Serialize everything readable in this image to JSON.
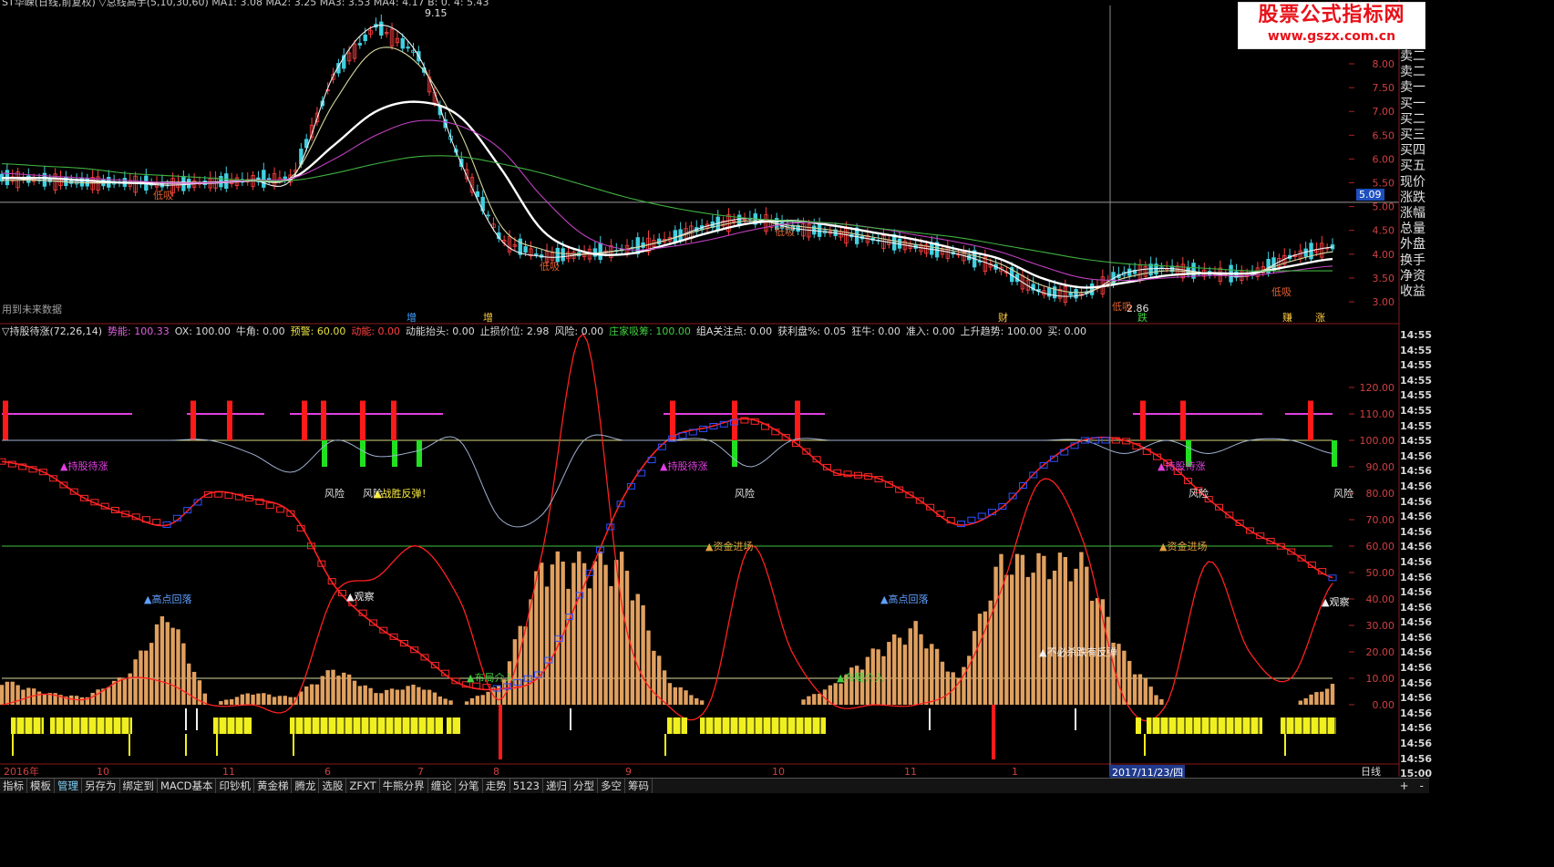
{
  "header_top": {
    "text": "ST华嵘(日线,前复权) ▽总线高手(5,10,30,60) MA1: 3.08 MA2: 3.25 MA3: 3.53 MA4: 4.17 B: 0. 4: 5.43"
  },
  "watermark": {
    "line1": "股票公式指标网",
    "line2": "www.gszx.com.cn"
  },
  "future_note": "用到未来数据",
  "indicator_header": [
    {
      "text": "▽持股待涨(72,26,14)",
      "color": "#dcdcdc"
    },
    {
      "text": "势能: 100.33",
      "color": "#e060e0"
    },
    {
      "text": "OX: 100.00",
      "color": "#dcdcdc"
    },
    {
      "text": "牛角: 0.00",
      "color": "#dcdcdc"
    },
    {
      "text": "预警: 60.00",
      "color": "#e8e040"
    },
    {
      "text": "动能: 0.00",
      "color": "#ff4040"
    },
    {
      "text": "动能抬头: 0.00",
      "color": "#dcdcdc"
    },
    {
      "text": "止损价位: 2.98",
      "color": "#dcdcdc"
    },
    {
      "text": "风险: 0.00",
      "color": "#dcdcdc"
    },
    {
      "text": "庄家吸筹: 100.00",
      "color": "#40d040"
    },
    {
      "text": "组A关注点: 0.00",
      "color": "#dcdcdc"
    },
    {
      "text": "获利盘%: 0.05",
      "color": "#dcdcdc"
    },
    {
      "text": "狂牛: 0.00",
      "color": "#dcdcdc"
    },
    {
      "text": "准入: 0.00",
      "color": "#dcdcdc"
    },
    {
      "text": "上升趋势: 100.00",
      "color": "#dcdcdc"
    },
    {
      "text": "买: 0.00",
      "color": "#dcdcdc"
    }
  ],
  "side_labels": [
    "卖二",
    "卖二",
    "卖一",
    "买一",
    "买二",
    "买三",
    "买四",
    "买五",
    "现价",
    "涨跌",
    "涨幅",
    "总量",
    "外盘",
    "换手",
    "净资",
    "收益"
  ],
  "time_labels": [
    "14:55",
    "14:55",
    "14:55",
    "14:55",
    "14:55",
    "14:55",
    "14:55",
    "14:55",
    "14:56",
    "14:56",
    "14:56",
    "14:56",
    "14:56",
    "14:56",
    "14:56",
    "14:56",
    "14:56",
    "14:56",
    "14:56",
    "14:56",
    "14:56",
    "14:56",
    "14:56",
    "14:56",
    "14:56",
    "14:56",
    "14:56",
    "14:56",
    "14:56",
    "15:00"
  ],
  "tabs": [
    "指标",
    "模板",
    "管理",
    "另存为",
    "绑定到",
    "MACD基本",
    "印钞机",
    "黄金梯",
    "腾龙",
    "选股",
    "ZFXT",
    "牛熊分界",
    "缠论",
    "分笔",
    "走势",
    "5123",
    "递归",
    "分型",
    "多空",
    "筹码"
  ],
  "active_tab": "管理",
  "day_badge": "日线",
  "cursor_date": "2017/11/23/四",
  "price_tag": "5.09",
  "tail_buttons": [
    "+",
    "-"
  ],
  "chart_data": [
    {
      "type": "line",
      "title": "ST华嵘(日线,前复权)",
      "y_axis": {
        "min": 3.0,
        "max": 8.0,
        "ticks": [
          8.0,
          7.5,
          7.0,
          6.5,
          6.0,
          5.5,
          5.0,
          4.5,
          4.0,
          3.5,
          3.0
        ],
        "tick_labels": [
          "8.00",
          "7.50",
          "7.00",
          "6.50",
          "6.00",
          "5.50",
          "5.00",
          "4.50",
          "4.00",
          "3.50",
          "3.00"
        ]
      },
      "x_time_labels": [
        "2016年",
        "10",
        "11",
        "6",
        "7",
        "8",
        "9",
        "10",
        "11",
        "1"
      ],
      "peak_label": "9.15",
      "low_label": "2.86",
      "price_level": 5.09,
      "series": [
        {
          "name": "MA1",
          "color": "#f0f0f0",
          "values": [
            5.6,
            5.55,
            5.5,
            5.5,
            5.45,
            5.5,
            5.55,
            5.6,
            7.8,
            8.8,
            8.2,
            6.0,
            4.3,
            3.95,
            4.0,
            4.1,
            4.3,
            4.6,
            4.75,
            4.55,
            4.45,
            4.3,
            4.15,
            4.0,
            3.7,
            3.2,
            3.15,
            3.6,
            3.7,
            3.6,
            3.55,
            3.95,
            4.15
          ]
        },
        {
          "name": "MA2",
          "color": "#d8d8a0",
          "values": [
            5.55,
            5.55,
            5.5,
            5.5,
            5.5,
            5.5,
            5.55,
            5.65,
            7.2,
            8.3,
            8.0,
            6.6,
            4.6,
            4.1,
            4.0,
            4.1,
            4.3,
            4.55,
            4.7,
            4.6,
            4.5,
            4.35,
            4.2,
            4.05,
            3.8,
            3.35,
            3.2,
            3.5,
            3.65,
            3.6,
            3.6,
            3.85,
            4.05
          ]
        },
        {
          "name": "MA3",
          "color": "#ffffff",
          "values": [
            5.6,
            5.6,
            5.55,
            5.5,
            5.5,
            5.5,
            5.55,
            5.6,
            6.3,
            7.0,
            7.2,
            6.9,
            5.8,
            4.5,
            4.05,
            4.0,
            4.2,
            4.45,
            4.65,
            4.7,
            4.6,
            4.45,
            4.3,
            4.1,
            3.9,
            3.5,
            3.3,
            3.4,
            3.55,
            3.6,
            3.6,
            3.75,
            3.9
          ]
        },
        {
          "name": "MA4",
          "color": "#c040c0",
          "values": [
            5.7,
            5.65,
            5.6,
            5.55,
            5.5,
            5.5,
            5.55,
            5.6,
            6.0,
            6.5,
            6.8,
            6.7,
            6.2,
            5.2,
            4.4,
            4.1,
            4.15,
            4.3,
            4.5,
            4.65,
            4.65,
            4.55,
            4.4,
            4.25,
            4.05,
            3.75,
            3.5,
            3.45,
            3.5,
            3.55,
            3.55,
            3.65,
            3.75
          ]
        },
        {
          "name": "MA5",
          "color": "#40b040",
          "values": [
            5.9,
            5.85,
            5.8,
            5.7,
            5.65,
            5.6,
            5.55,
            5.55,
            5.7,
            5.9,
            6.05,
            6.05,
            5.9,
            5.7,
            5.45,
            5.2,
            5.0,
            4.85,
            4.75,
            4.7,
            4.65,
            4.55,
            4.45,
            4.35,
            4.2,
            4.05,
            3.9,
            3.8,
            3.75,
            3.7,
            3.65,
            3.65,
            3.65
          ]
        }
      ],
      "annotations": [
        "低吸",
        "低吸",
        "低吸",
        "低吸",
        "增",
        "增",
        "财",
        "跌",
        "低吸",
        "赚",
        "涨"
      ]
    },
    {
      "type": "line",
      "title": "持股待涨",
      "y_axis": {
        "min": 0,
        "max": 120,
        "ticks": [
          120,
          110,
          100,
          90,
          80,
          70,
          60,
          50,
          40,
          30,
          20,
          10,
          0
        ],
        "tick_labels": [
          "120.00",
          "110.00",
          "100.00",
          "90.00",
          "80.00",
          "70.00",
          "60.00",
          "50.00",
          "40.00",
          "30.00",
          "20.00",
          "10.00",
          "0.00"
        ]
      },
      "reference_lines": [
        100,
        60,
        10
      ],
      "series": [
        {
          "name": "势能",
          "color": "#e040e0",
          "values": [
            110,
            110,
            110,
            110,
            110,
            110,
            110,
            110,
            110,
            110,
            110,
            110,
            110,
            110,
            110,
            110,
            110,
            110,
            110,
            110,
            110,
            110,
            110,
            110,
            110,
            110,
            110,
            110,
            110,
            110,
            110,
            110,
            110
          ]
        },
        {
          "name": "趋势",
          "color": "#ff2020",
          "values": [
            92,
            88,
            78,
            72,
            68,
            80,
            78,
            72,
            45,
            30,
            20,
            8,
            6,
            12,
            45,
            80,
            100,
            105,
            108,
            100,
            88,
            86,
            78,
            68,
            74,
            90,
            100,
            100,
            92,
            78,
            66,
            58,
            48
          ]
        },
        {
          "name": "动能",
          "color": "#ff2020",
          "values": [
            0,
            4,
            2,
            10,
            8,
            0,
            0,
            0,
            42,
            48,
            60,
            40,
            2,
            58,
            140,
            30,
            0,
            0,
            60,
            20,
            0,
            0,
            0,
            8,
            42,
            85,
            62,
            2,
            0,
            54,
            20,
            10,
            46
          ]
        },
        {
          "name": "风险",
          "color": "#a0b0d0",
          "values": [
            100,
            100,
            100,
            100,
            100,
            100,
            95,
            88,
            100,
            94,
            96,
            100,
            70,
            72,
            100,
            100,
            100,
            100,
            90,
            100,
            100,
            100,
            100,
            100,
            100,
            100,
            100,
            95,
            100,
            95,
            100,
            100,
            95
          ]
        },
        {
          "name": "吸筹",
          "color": "#e0a060",
          "values": [
            10,
            5,
            3,
            12,
            38,
            0,
            5,
            3,
            15,
            5,
            8,
            0,
            8,
            58,
            58,
            58,
            10,
            0,
            0,
            0,
            8,
            22,
            32,
            10,
            58,
            58,
            58,
            20,
            0,
            0,
            0,
            0,
            8
          ]
        }
      ],
      "annotations": [
        "▲持股待涨",
        "风险",
        "风险",
        "▲持股待涨",
        "风险",
        "▲持股待涨",
        "风险",
        "风险",
        "▲资金进场",
        "▲资金进场",
        "▲高点回落",
        "▲高点回落",
        "▲观察",
        "▲观察",
        "▲布局介入",
        "▲布局介入",
        "▲不必杀跌有反弹",
        "▲战胜反弹！"
      ]
    }
  ]
}
